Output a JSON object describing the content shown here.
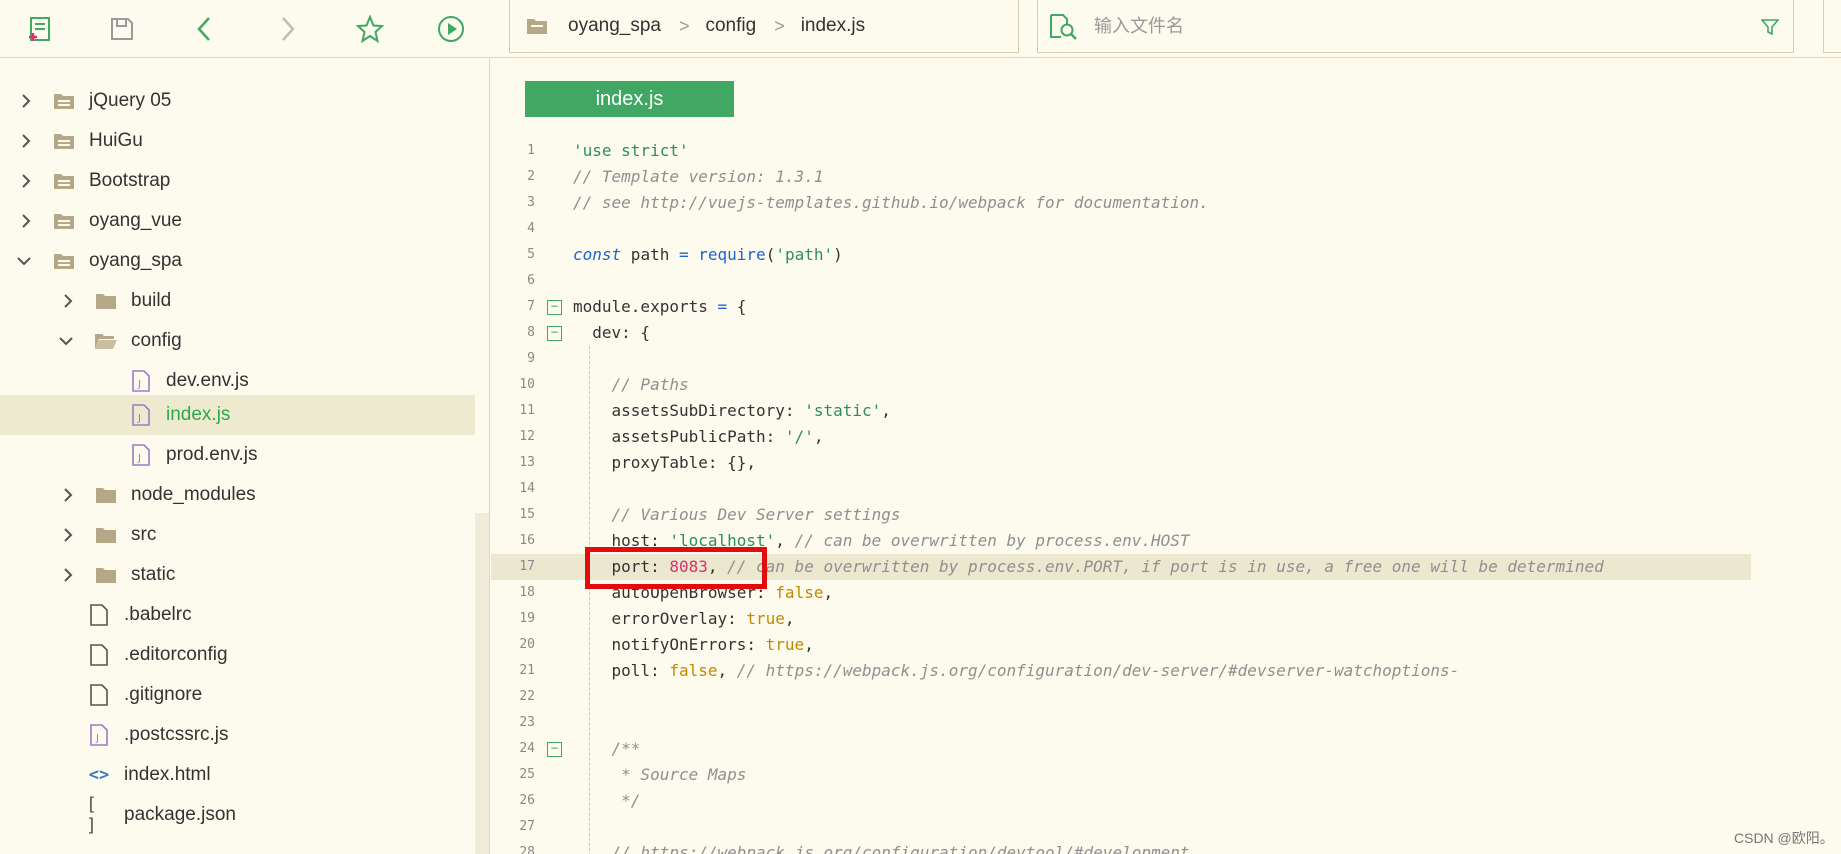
{
  "toolbar": {
    "icons": [
      "new-file-icon",
      "save-icon",
      "back-icon",
      "forward-icon",
      "star-icon",
      "run-icon"
    ],
    "accent": "#41a863"
  },
  "breadcrumb": {
    "items": [
      "oyang_spa",
      "config",
      "index.js"
    ],
    "separator": ">"
  },
  "search": {
    "placeholder": "输入文件名",
    "value": ""
  },
  "sidebar": {
    "items": [
      {
        "label": "jQuery 05",
        "type": "folder",
        "expanded": false
      },
      {
        "label": "HuiGu",
        "type": "folder",
        "expanded": false
      },
      {
        "label": "Bootstrap",
        "type": "folder",
        "expanded": false
      },
      {
        "label": "oyang_vue",
        "type": "folder",
        "expanded": false
      },
      {
        "label": "oyang_spa",
        "type": "folder",
        "expanded": true
      },
      {
        "label": "build",
        "type": "folder",
        "expanded": false
      },
      {
        "label": "config",
        "type": "folder-open",
        "expanded": true
      },
      {
        "label": "dev.env.js",
        "type": "js-file"
      },
      {
        "label": "index.js",
        "type": "js-file",
        "active": true
      },
      {
        "label": "prod.env.js",
        "type": "js-file"
      },
      {
        "label": "node_modules",
        "type": "folder",
        "expanded": false
      },
      {
        "label": "src",
        "type": "folder",
        "expanded": false
      },
      {
        "label": "static",
        "type": "folder",
        "expanded": false
      },
      {
        "label": ".babelrc",
        "type": "file"
      },
      {
        "label": ".editorconfig",
        "type": "file"
      },
      {
        "label": ".gitignore",
        "type": "file"
      },
      {
        "label": ".postcssrc.js",
        "type": "js-file"
      },
      {
        "label": "index.html",
        "type": "html-file"
      },
      {
        "label": "package.json",
        "type": "json-file"
      }
    ]
  },
  "editor": {
    "tab_label": "index.js",
    "lines": [
      {
        "n": "1",
        "text": "'use strict'"
      },
      {
        "n": "2",
        "text": "// Template version: 1.3.1"
      },
      {
        "n": "3",
        "text": "// see http://vuejs-templates.github.io/webpack for documentation."
      },
      {
        "n": "4",
        "text": ""
      },
      {
        "n": "5",
        "text": "const path = require('path')"
      },
      {
        "n": "6",
        "text": ""
      },
      {
        "n": "7",
        "text": "module.exports = {"
      },
      {
        "n": "8",
        "text": "  dev: {"
      },
      {
        "n": "9",
        "text": ""
      },
      {
        "n": "10",
        "text": "    // Paths"
      },
      {
        "n": "11",
        "text": "    assetsSubDirectory: 'static',"
      },
      {
        "n": "12",
        "text": "    assetsPublicPath: '/',"
      },
      {
        "n": "13",
        "text": "    proxyTable: {},"
      },
      {
        "n": "14",
        "text": ""
      },
      {
        "n": "15",
        "text": "    // Various Dev Server settings"
      },
      {
        "n": "16",
        "text": "    host: 'localhost', // can be overwritten by process.env.HOST"
      },
      {
        "n": "17",
        "text": "    port: 8083, // can be overwritten by process.env.PORT, if port is in use, a free one will be determined"
      },
      {
        "n": "18",
        "text": "    autoOpenBrowser: false,"
      },
      {
        "n": "19",
        "text": "    errorOverlay: true,"
      },
      {
        "n": "20",
        "text": "    notifyOnErrors: true,"
      },
      {
        "n": "21",
        "text": "    poll: false, // https://webpack.js.org/configuration/dev-server/#devserver-watchoptions-"
      },
      {
        "n": "22",
        "text": ""
      },
      {
        "n": "23",
        "text": ""
      },
      {
        "n": "24",
        "text": "    /**"
      },
      {
        "n": "25",
        "text": "     * Source Maps"
      },
      {
        "n": "26",
        "text": "     */"
      },
      {
        "n": "27",
        "text": ""
      },
      {
        "n": "28",
        "text": "    // https://webpack.js.org/configuration/devtool/#development"
      }
    ],
    "highlighted_line": "17",
    "highlight_annotation_color": "#e20c0c"
  },
  "watermark": "CSDN @欧阳。"
}
